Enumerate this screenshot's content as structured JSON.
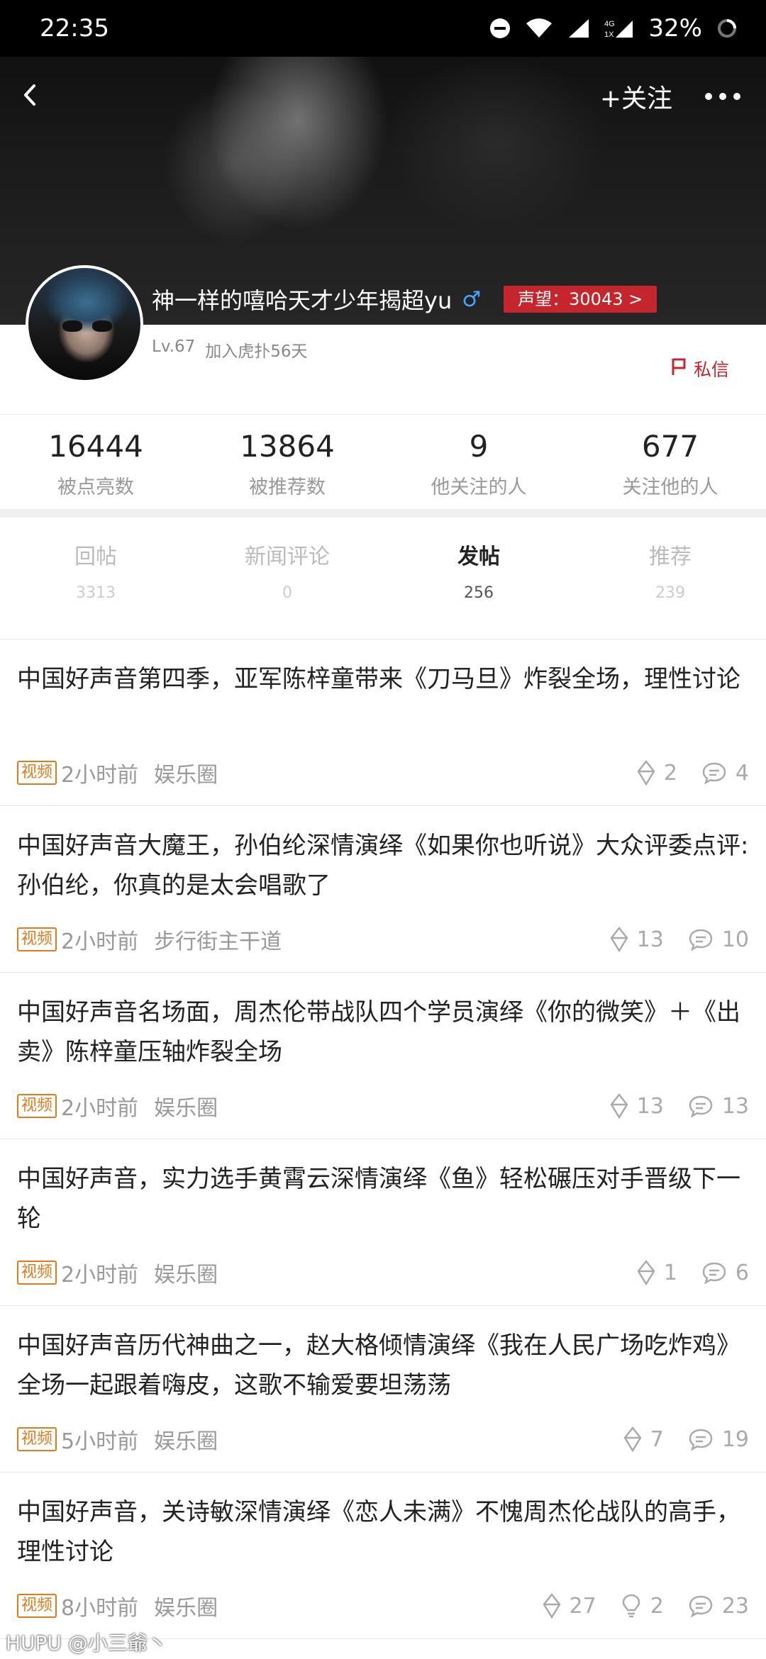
{
  "status_bar": {
    "time": "22:35",
    "network": "4G\n1X",
    "battery": "32%"
  },
  "header": {
    "follow_label": "+关注",
    "username": "神一样的嘻哈天才少年揭超yu",
    "gender_symbol": "♂",
    "reputation": "声望：30043 >",
    "level": "Lv.67",
    "joined": "加入虎扑56天",
    "message_label": "私信"
  },
  "stats": [
    {
      "value": "16444",
      "label": "被点亮数"
    },
    {
      "value": "13864",
      "label": "被推荐数"
    },
    {
      "value": "9",
      "label": "他关注的人"
    },
    {
      "value": "677",
      "label": "关注他的人"
    }
  ],
  "tabs": [
    {
      "label": "回帖",
      "count": "3313"
    },
    {
      "label": "新闻评论",
      "count": "0"
    },
    {
      "label": "发帖",
      "count": "256"
    },
    {
      "label": "推荐",
      "count": "239"
    }
  ],
  "active_tab": "发帖",
  "tag_video": "视频",
  "posts": [
    {
      "title": "中国好声音第四季，亚军陈梓童带来《刀马旦》炸裂全场，理性讨论",
      "time": "2小时前",
      "board": "娱乐圈",
      "likes": "2",
      "comments": "4"
    },
    {
      "title": "中国好声音大魔王，孙伯纶深情演绎《如果你也听说》大众评委点评:孙伯纶，你真的是太会唱歌了",
      "time": "2小时前",
      "board": "步行街主干道",
      "likes": "13",
      "comments": "10"
    },
    {
      "title": "中国好声音名场面，周杰伦带战队四个学员演绎《你的微笑》＋《出卖》陈梓童压轴炸裂全场",
      "time": "2小时前",
      "board": "娱乐圈",
      "likes": "13",
      "comments": "13"
    },
    {
      "title": "中国好声音，实力选手黄霄云深情演绎《鱼》轻松碾压对手晋级下一轮",
      "time": "2小时前",
      "board": "娱乐圈",
      "likes": "1",
      "comments": "6"
    },
    {
      "title": "中国好声音历代神曲之一，赵大格倾情演绎《我在人民广场吃炸鸡》全场一起跟着嗨皮，这歌不输爱要坦荡荡",
      "time": "5小时前",
      "board": "娱乐圈",
      "likes": "7",
      "comments": "19"
    },
    {
      "title": "中国好声音，关诗敏深情演绎《恋人未满》不愧周杰伦战队的高手，理性讨论",
      "time": "8小时前",
      "board": "娱乐圈",
      "likes": "27",
      "recommends": "2",
      "comments": "23"
    }
  ],
  "watermark": "HUPU @小三爺丶"
}
